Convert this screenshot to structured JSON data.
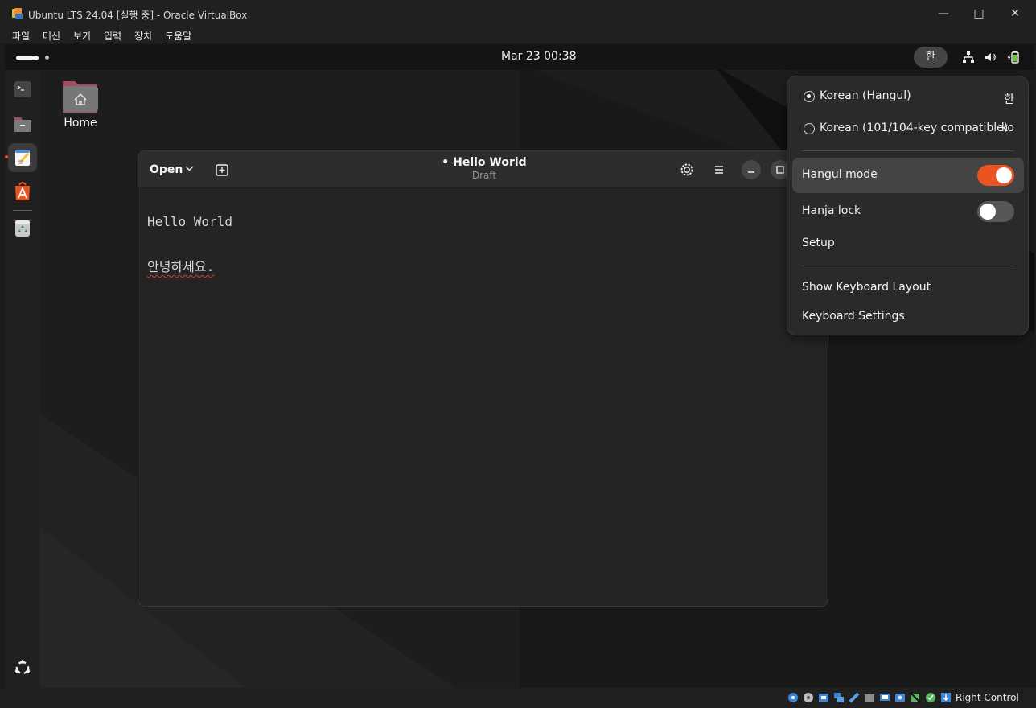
{
  "host": {
    "title": "Ubuntu LTS 24.04 [실행 중] - Oracle VirtualBox",
    "menu": [
      "파일",
      "머신",
      "보기",
      "입력",
      "장치",
      "도움말"
    ],
    "status": "Right Control"
  },
  "ubuntu": {
    "clock": "Mar 23  00:38",
    "ime": "한",
    "desktop": {
      "home_label": "Home"
    }
  },
  "editor": {
    "open_label": "Open",
    "title": "• Hello World",
    "subtitle": "Draft",
    "lines": [
      "Hello World",
      "안녕하세요."
    ]
  },
  "ime_menu": {
    "option1": "Korean (Hangul)",
    "option1_trailing": "한",
    "option2": "Korean (101/104-key compatible)",
    "option2_trailing": "ko",
    "hangul_mode": "Hangul mode",
    "hanja_lock": "Hanja lock",
    "setup": "Setup",
    "show_layout": "Show Keyboard Layout",
    "keyboard_settings": "Keyboard Settings"
  },
  "colors": {
    "accent": "#e95420"
  }
}
